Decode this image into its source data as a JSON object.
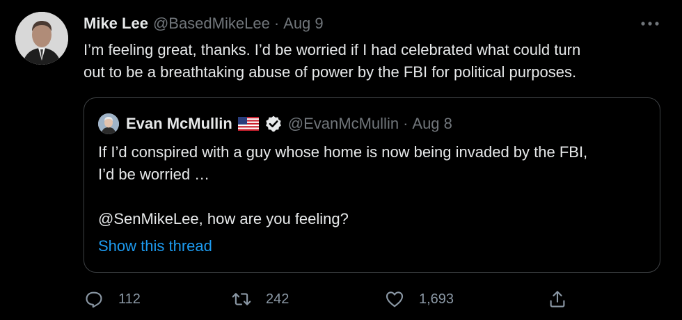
{
  "tweet": {
    "author_name": "Mike Lee",
    "handle": "@BasedMikeLee",
    "separator": "·",
    "date": "Aug 9",
    "text": "I’m feeling great, thanks.  I’d be worried if I had celebrated what could turn\nout to be a breathtaking abuse of power by the FBI for political purposes."
  },
  "quote": {
    "author_name": "Evan McMullin",
    "flag_icon": "us-flag-icon",
    "verified_icon": "verified-badge-icon",
    "handle": "@EvanMcMullin",
    "separator": "·",
    "date": "Aug 8",
    "text": "If I’d conspired with a guy whose home is now being invaded by the FBI,\nI’d be worried …\n\n@SenMikeLee, how are you feeling?",
    "show_thread_label": "Show this thread"
  },
  "actions": {
    "reply_count": "112",
    "retweet_count": "242",
    "like_count": "1,693"
  },
  "colors": {
    "background": "#000000",
    "text": "#e7e9ea",
    "muted": "#71767b",
    "link": "#1d9bf0",
    "border": "#3e4144"
  }
}
